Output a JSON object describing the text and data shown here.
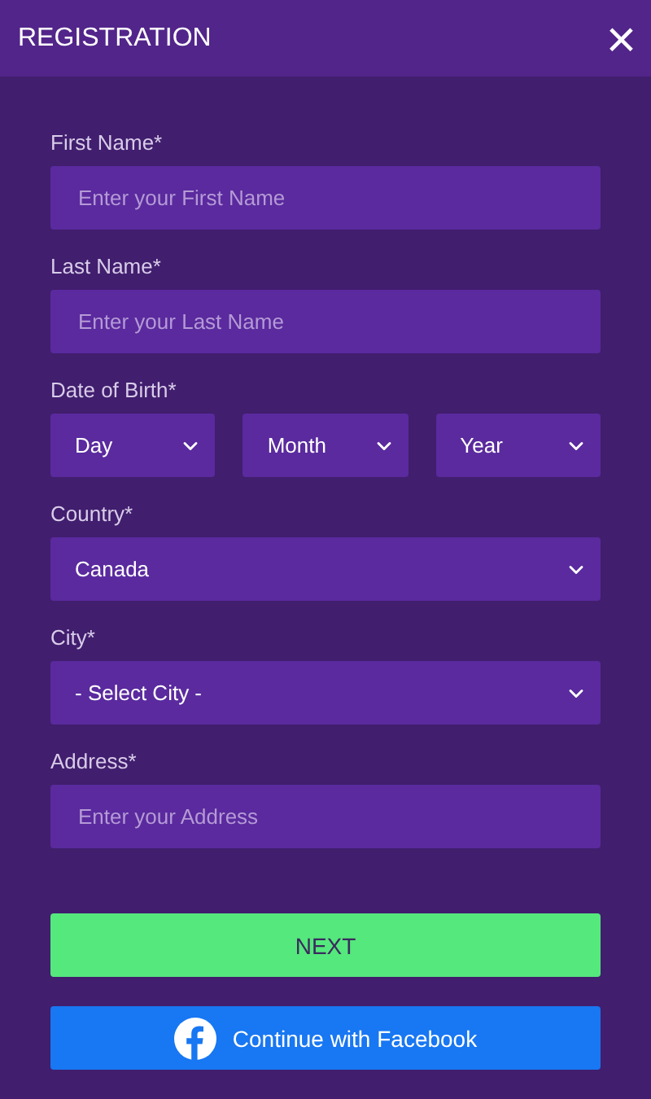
{
  "header": {
    "title": "REGISTRATION",
    "close": "×"
  },
  "fields": [
    {
      "kind": "text",
      "label": "First Name*",
      "placeholder": "Enter your First Name"
    },
    {
      "kind": "text",
      "label": "Last Name*",
      "placeholder": "Enter your Last Name"
    },
    {
      "kind": "selects",
      "label": "Date of Birth*",
      "selects": [
        "Day",
        "Month",
        "Year"
      ]
    },
    {
      "kind": "select",
      "label": "Country*",
      "value": "Canada"
    },
    {
      "kind": "select",
      "label": "City*",
      "value": "- Select City -"
    },
    {
      "kind": "text",
      "label": "Address*",
      "placeholder": "Enter your Address"
    }
  ],
  "next_button": "NEXT",
  "facebook_button": "Continue with Facebook"
}
